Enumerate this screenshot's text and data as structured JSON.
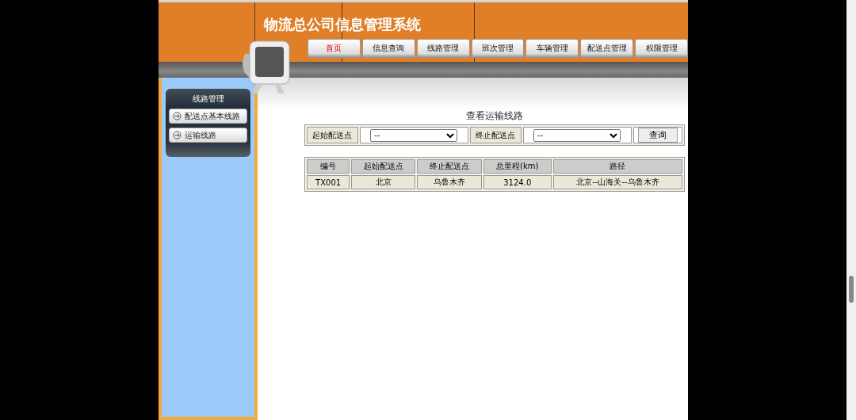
{
  "header": {
    "title": "物流总公司信息管理系统"
  },
  "nav_tabs": [
    {
      "label": "首页",
      "selected": true
    },
    {
      "label": "信息查询",
      "selected": false
    },
    {
      "label": "线路管理",
      "selected": false
    },
    {
      "label": "班次管理",
      "selected": false
    },
    {
      "label": "车辆管理",
      "selected": false
    },
    {
      "label": "配送点管理",
      "selected": false
    },
    {
      "label": "权限管理",
      "selected": false
    }
  ],
  "sidebar": {
    "heading": "线路管理",
    "items": [
      {
        "label": "配送点基本线路"
      },
      {
        "label": "运输线路"
      }
    ]
  },
  "main": {
    "title": "查看运输线路",
    "search": {
      "start_label": "起始配送点",
      "start_value": "--",
      "end_label": "终止配送点",
      "end_value": "--",
      "button": "查询"
    },
    "table": {
      "columns": [
        "编号",
        "起始配送点",
        "终止配送点",
        "总里程(km)",
        "路径"
      ],
      "rows": [
        [
          "TX001",
          "北京",
          "乌鲁木齐",
          "3124.0",
          "北京--山海关--乌鲁木齐"
        ]
      ]
    }
  }
}
